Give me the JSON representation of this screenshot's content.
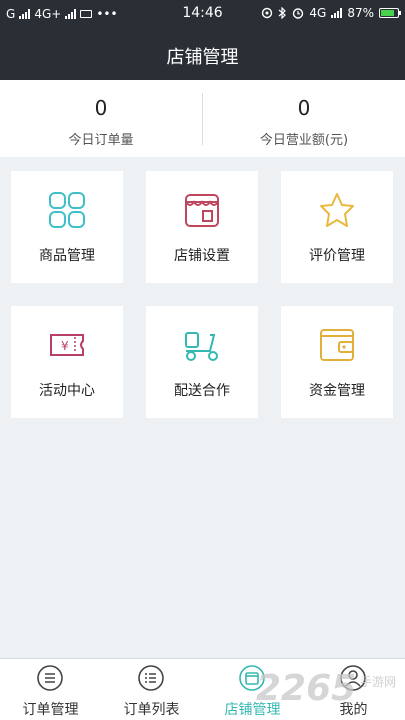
{
  "status_bar": {
    "carrier": "G",
    "network": "4G+",
    "more": "•••",
    "time": "14:46",
    "network_right": "4G",
    "battery": "87%"
  },
  "header": {
    "title": "店铺管理"
  },
  "stats": [
    {
      "value": "0",
      "label": "今日订单量"
    },
    {
      "value": "0",
      "label": "今日营业额(元)"
    }
  ],
  "tiles": [
    {
      "label": "商品管理",
      "icon": "product-grid-icon",
      "color": "#3fbfc7"
    },
    {
      "label": "店铺设置",
      "icon": "storefront-icon",
      "color": "#c0465f"
    },
    {
      "label": "评价管理",
      "icon": "star-icon",
      "color": "#e9b83d"
    },
    {
      "label": "活动中心",
      "icon": "ticket-icon",
      "color": "#b83f66"
    },
    {
      "label": "配送合作",
      "icon": "delivery-scooter-icon",
      "color": "#35b8b1"
    },
    {
      "label": "资金管理",
      "icon": "wallet-icon",
      "color": "#e2b03a"
    }
  ],
  "tabbar": {
    "active_color": "#35b8b1",
    "items": [
      {
        "label": "订单管理",
        "icon": "list-circle-icon"
      },
      {
        "label": "订单列表",
        "icon": "list-circle-icon"
      },
      {
        "label": "店铺管理",
        "icon": "store-circle-icon",
        "active": true
      },
      {
        "label": "我的",
        "icon": "person-circle-icon"
      }
    ]
  },
  "watermark": {
    "text": "2265",
    "suffix": "手游网"
  }
}
